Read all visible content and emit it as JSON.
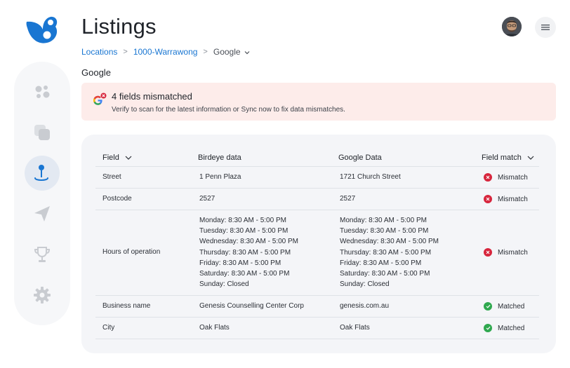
{
  "header": {
    "title": "Listings"
  },
  "breadcrumb": {
    "items": [
      "Locations",
      "1000-Warrawong"
    ],
    "current": "Google",
    "separator": ">"
  },
  "section_label": "Google",
  "alert": {
    "title": "4 fields mismatched",
    "message": "Verify to scan for the latest information or Sync now to fix data mismatches.",
    "background": "#fdecea"
  },
  "table": {
    "headers": {
      "field": "Field",
      "birdeye": "Birdeye data",
      "google": "Google Data",
      "match": "Field match"
    },
    "rows": [
      {
        "field": "Street",
        "birdeye": "1 Penn Plaza",
        "google": "1721 Church Street",
        "status": "Mismatch"
      },
      {
        "field": "Postcode",
        "birdeye": "2527",
        "google": "2527",
        "status": "Mismatch"
      },
      {
        "field": "Hours of operation",
        "birdeye_hours": [
          "Monday: 8:30 AM - 5:00 PM",
          "Tuesday: 8:30 AM - 5:00 PM",
          "Wednesday: 8:30 AM - 5:00 PM",
          "Thursday: 8:30 AM - 5:00 PM",
          "Friday: 8:30 AM - 5:00 PM",
          "Saturday: 8:30 AM - 5:00 PM",
          "Sunday: Closed"
        ],
        "google_hours": [
          "Monday: 8:30 AM - 5:00 PM",
          "Tuesday: 8:30 AM - 5:00 PM",
          "Wednesday: 8:30 AM - 5:00 PM",
          "Thursday: 8:30 AM - 5:00 PM",
          "Friday: 8:30 AM - 5:00 PM",
          "Saturday: 8:30 AM - 5:00 PM",
          "Sunday: Closed"
        ],
        "status": "Mismatch"
      },
      {
        "field": "Business name",
        "birdeye": "Genesis Counselling Center Corp",
        "google": "genesis.com.au",
        "status": "Matched"
      },
      {
        "field": "City",
        "birdeye": "Oak Flats",
        "google": "Oak Flats",
        "status": "Matched"
      }
    ]
  },
  "sidebar": {
    "items": [
      {
        "icon": "dashboard-icon"
      },
      {
        "icon": "stack-icon"
      },
      {
        "icon": "location-pin-icon",
        "active": true
      },
      {
        "icon": "send-icon"
      },
      {
        "icon": "trophy-icon"
      },
      {
        "icon": "gear-icon"
      }
    ]
  },
  "colors": {
    "brand": "#1976d2",
    "mismatch": "#d7263d",
    "matched": "#2fa84f",
    "sidebar_icon": "#c9ccd1"
  },
  "icons": {
    "logo": "birdeye-logo-icon",
    "avatar": "user-avatar",
    "menu": "hamburger-menu-icon",
    "alert": "google-error-icon"
  }
}
